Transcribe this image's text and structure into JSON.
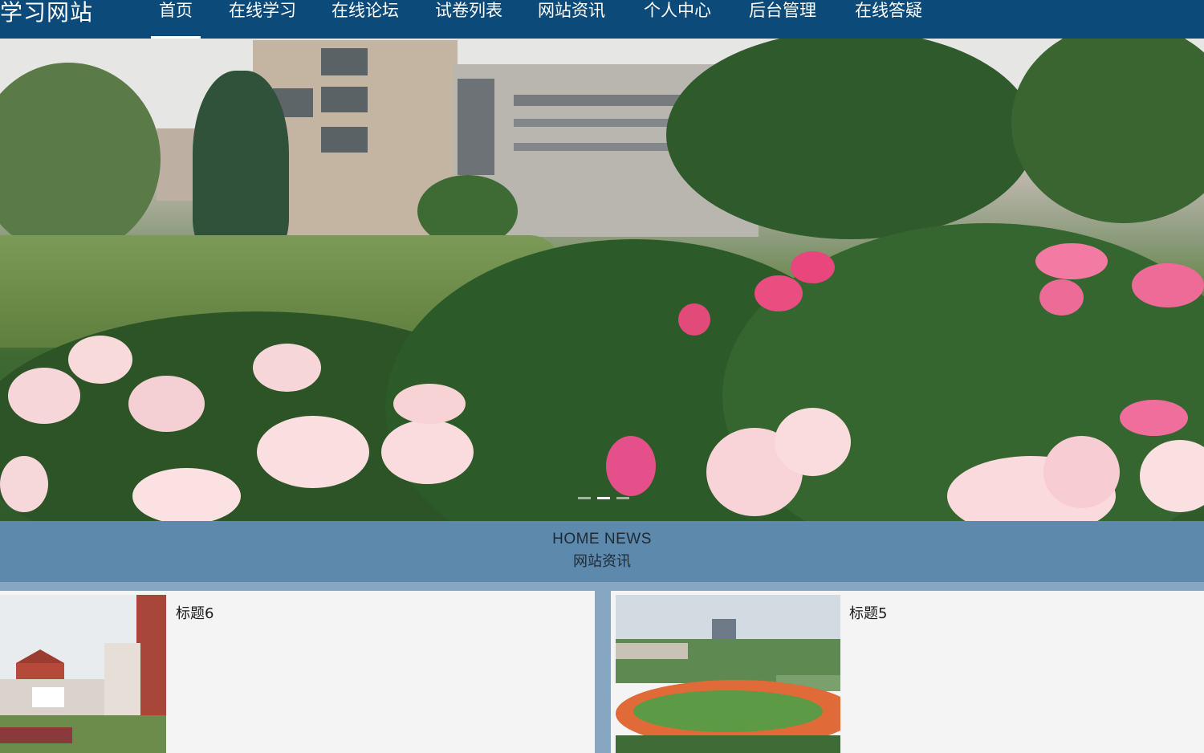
{
  "site": {
    "brand": "学习网站"
  },
  "nav": {
    "items": [
      {
        "label": "首页",
        "active": true
      },
      {
        "label": "在线学习",
        "active": false
      },
      {
        "label": "在线论坛",
        "active": false
      },
      {
        "label": "试卷列表",
        "active": false
      },
      {
        "label": "网站资讯",
        "active": false
      },
      {
        "label": "个人中心",
        "active": false
      },
      {
        "label": "后台管理",
        "active": false
      },
      {
        "label": "在线答疑",
        "active": false
      }
    ]
  },
  "carousel": {
    "slide_count": 3,
    "active_index": 1
  },
  "news_section": {
    "title_en": "HOME NEWS",
    "title_cn": "网站资讯"
  },
  "news": [
    {
      "title": "标题6"
    },
    {
      "title": "标题5"
    }
  ],
  "colors": {
    "nav_bg": "#0b4a79",
    "section_bg": "#5c89ac",
    "page_bg": "#86a6c2",
    "card_bg": "#f4f4f4"
  }
}
